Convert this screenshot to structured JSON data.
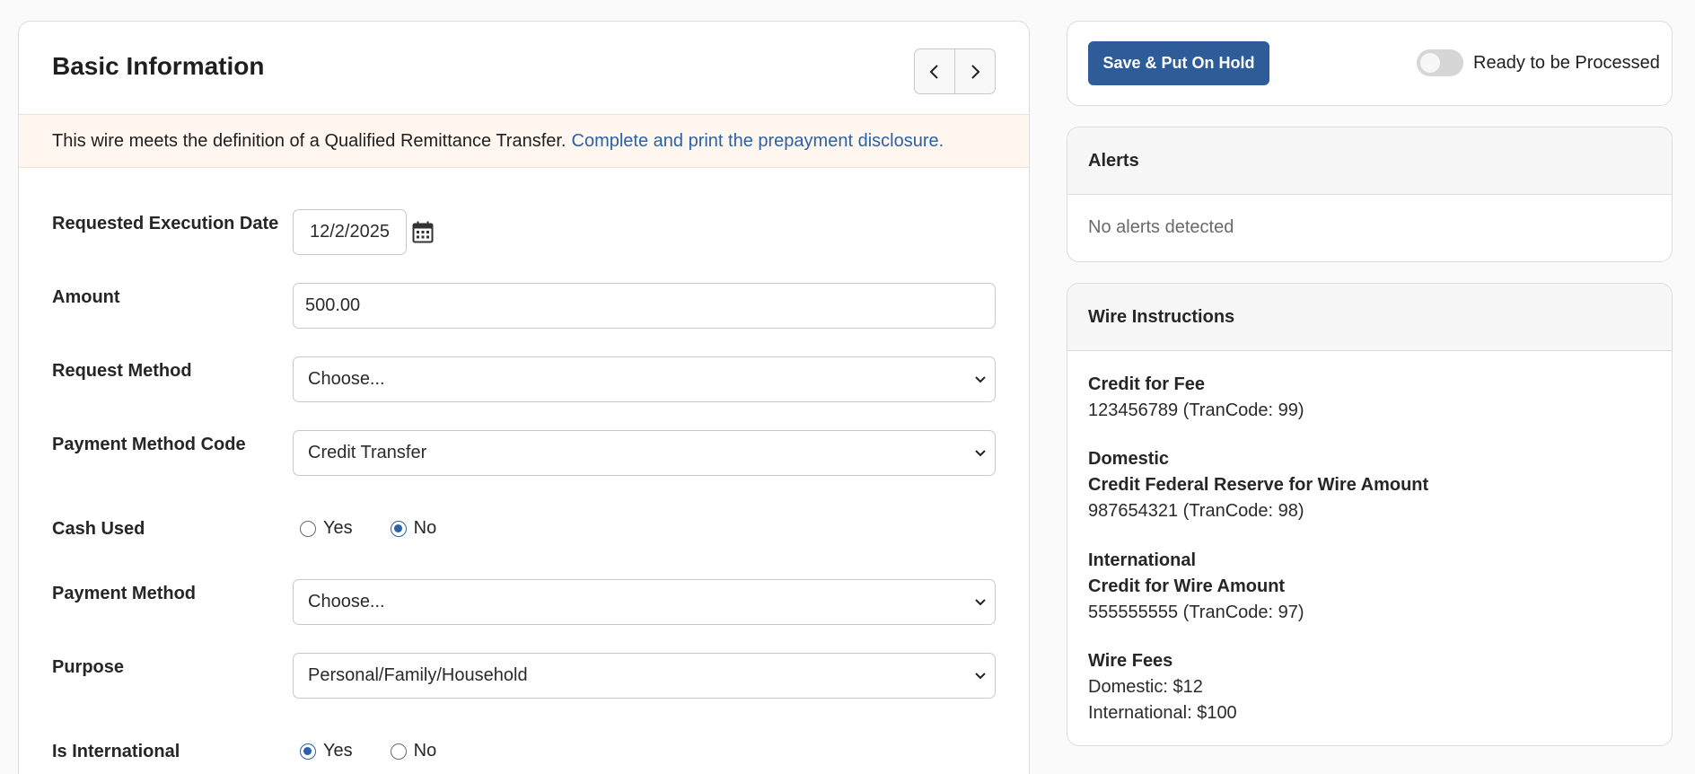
{
  "basic_info": {
    "title": "Basic Information",
    "prev_label": "‹",
    "next_label": "›"
  },
  "notice": {
    "text": "This wire meets the definition of a Qualified Remittance Transfer.",
    "link_text": "Complete and print the prepayment disclosure."
  },
  "form": {
    "execution_date": {
      "label": "Requested Execution Date",
      "value": "12/2/2025"
    },
    "amount": {
      "label": "Amount",
      "value": "500.00"
    },
    "request_method": {
      "label": "Request Method",
      "value": "Choose..."
    },
    "payment_method_code": {
      "label": "Payment Method Code",
      "value": "Credit Transfer"
    },
    "cash_used": {
      "label": "Cash Used",
      "options": [
        "Yes",
        "No"
      ],
      "selected": "No"
    },
    "payment_method": {
      "label": "Payment Method",
      "value": "Choose..."
    },
    "purpose": {
      "label": "Purpose",
      "value": "Personal/Family/Household"
    },
    "is_international": {
      "label": "Is International",
      "options": [
        "Yes",
        "No"
      ],
      "selected": "Yes"
    }
  },
  "actions": {
    "save_hold_label": "Save & Put On Hold",
    "ready_toggle_label": "Ready to be Processed",
    "ready_toggle_on": false
  },
  "alerts": {
    "title": "Alerts",
    "empty_text": "No alerts detected"
  },
  "wire_instructions": {
    "title": "Wire Instructions",
    "credit_fee_heading": "Credit for Fee",
    "credit_fee_value": "123456789 (TranCode: 99)",
    "domestic_heading": "Domestic",
    "domestic_subheading": "Credit Federal Reserve for Wire Amount",
    "domestic_value": "987654321 (TranCode: 98)",
    "international_heading": "International",
    "international_subheading": "Credit for Wire Amount",
    "international_value": "555555555 (TranCode: 97)",
    "fees_heading": "Wire Fees",
    "fees_domestic": "Domestic: $12",
    "fees_international": "International: $100"
  },
  "colors": {
    "primary": "#2d5c98",
    "link": "#2a62a6",
    "notice_bg": "#fff7ef"
  },
  "icons": {
    "calendar": "calendar-icon",
    "chevron": "chevron-down-icon",
    "prev": "chevron-left-icon",
    "next": "chevron-right-icon"
  }
}
